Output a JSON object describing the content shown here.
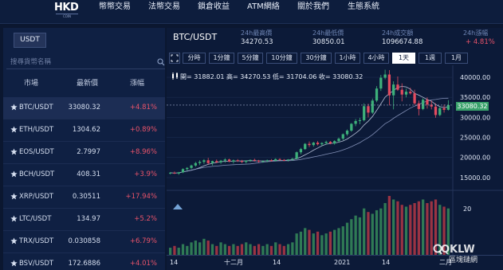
{
  "logo": {
    "text": "HKD",
    "sub": "COIN"
  },
  "nav": [
    {
      "label": "幣幣交易"
    },
    {
      "label": "法幣交易"
    },
    {
      "label": "鎖倉收益"
    },
    {
      "label": "ATM網絡"
    },
    {
      "label": "關於我們"
    },
    {
      "label": "生態系統"
    }
  ],
  "market": {
    "quote_tab": "USDT",
    "search_placeholder": "搜尋貨幣名稱",
    "headers": {
      "market": "市場",
      "price": "最新價",
      "change": "漲幅"
    },
    "rows": [
      {
        "pair": "BTC/USDT",
        "price": "33080.32",
        "change": "+4.81%",
        "selected": true
      },
      {
        "pair": "ETH/USDT",
        "price": "1304.62",
        "change": "+0.89%"
      },
      {
        "pair": "EOS/USDT",
        "price": "2.7997",
        "change": "+8.96%"
      },
      {
        "pair": "BCH/USDT",
        "price": "408.31",
        "change": "+3.9%"
      },
      {
        "pair": "XRP/USDT",
        "price": "0.30511",
        "change": "+17.94%"
      },
      {
        "pair": "LTC/USDT",
        "price": "134.97",
        "change": "+5.2%"
      },
      {
        "pair": "TRX/USDT",
        "price": "0.030858",
        "change": "+6.79%"
      },
      {
        "pair": "BSV/USDT",
        "price": "172.6886",
        "change": "+4.01%"
      }
    ]
  },
  "ticker": {
    "symbol": "BTC/USDT",
    "high_label": "24h最高價",
    "high": "34270.53",
    "low_label": "24h最低價",
    "low": "30850.01",
    "vol_label": "24h成交額",
    "vol": "1096674.88",
    "chg_label": "24h漲幅",
    "chg": "+ 4.81%"
  },
  "intervals": [
    {
      "label": "分時"
    },
    {
      "label": "1分鐘"
    },
    {
      "label": "5分鐘"
    },
    {
      "label": "10分鐘"
    },
    {
      "label": "30分鐘"
    },
    {
      "label": "1小時"
    },
    {
      "label": "4小時"
    },
    {
      "label": "1天",
      "active": true
    },
    {
      "label": "1週"
    },
    {
      "label": "1月"
    }
  ],
  "ohlc": "開= 31882.01  高= 34270.53  低= 31704.06  收= 33080.32",
  "last_price_tag": "33080.32",
  "chart_data": {
    "type": "candlestick",
    "y_ticks": [
      "40000.00",
      "35000.00",
      "30000.00",
      "25000.00",
      "20000.00",
      "15000.00"
    ],
    "ylim": [
      12000,
      42000
    ],
    "x_ticks": [
      "14",
      "十二月",
      "14",
      "2021",
      "14",
      "二月"
    ],
    "volume_tick": "20",
    "ohlc_series": [
      [
        16100,
        16350,
        15800,
        16200
      ],
      [
        16200,
        16500,
        15900,
        16000
      ],
      [
        16000,
        16400,
        15700,
        16300
      ],
      [
        16300,
        17300,
        16100,
        17100
      ],
      [
        17100,
        17600,
        16700,
        17400
      ],
      [
        17400,
        18200,
        17100,
        18000
      ],
      [
        18000,
        18900,
        17700,
        18600
      ],
      [
        18600,
        19300,
        18100,
        18900
      ],
      [
        18900,
        19600,
        18400,
        19300
      ],
      [
        19300,
        19900,
        18300,
        18600
      ],
      [
        18600,
        19200,
        18000,
        19100
      ],
      [
        19100,
        19500,
        18600,
        18800
      ],
      [
        18800,
        19400,
        18400,
        19200
      ],
      [
        19200,
        19800,
        18700,
        19500
      ],
      [
        19500,
        19700,
        18800,
        19000
      ],
      [
        19000,
        19500,
        18500,
        19300
      ],
      [
        19300,
        19600,
        18900,
        19100
      ],
      [
        19100,
        19400,
        18600,
        18900
      ],
      [
        18900,
        19300,
        18500,
        19200
      ],
      [
        19200,
        19500,
        18900,
        19400
      ],
      [
        19400,
        19700,
        19000,
        19200
      ],
      [
        19200,
        19400,
        18700,
        19000
      ],
      [
        19000,
        19300,
        18700,
        19100
      ],
      [
        19100,
        19500,
        18800,
        19300
      ],
      [
        19300,
        19600,
        19000,
        19200
      ],
      [
        19200,
        19800,
        19000,
        19600
      ],
      [
        19600,
        19800,
        19200,
        19400
      ],
      [
        19400,
        19600,
        19100,
        19300
      ],
      [
        19300,
        19600,
        19000,
        19500
      ],
      [
        19500,
        19900,
        19200,
        19700
      ],
      [
        19700,
        21500,
        19500,
        21300
      ],
      [
        21300,
        22400,
        20800,
        22100
      ],
      [
        22100,
        23600,
        21900,
        23400
      ],
      [
        23400,
        24000,
        22600,
        23100
      ],
      [
        23100,
        23900,
        22700,
        23700
      ],
      [
        23700,
        24100,
        23000,
        23300
      ],
      [
        23300,
        23800,
        22900,
        23600
      ],
      [
        23600,
        24200,
        23200,
        23900
      ],
      [
        23900,
        24100,
        23300,
        23500
      ],
      [
        23500,
        24300,
        23200,
        24100
      ],
      [
        24100,
        25000,
        23800,
        24700
      ],
      [
        24700,
        26000,
        24300,
        25800
      ],
      [
        25800,
        27000,
        25400,
        26700
      ],
      [
        26700,
        28600,
        26400,
        28400
      ],
      [
        28400,
        29600,
        27800,
        29100
      ],
      [
        29100,
        29900,
        28300,
        29300
      ],
      [
        29300,
        33500,
        29000,
        32800
      ],
      [
        32800,
        33400,
        30000,
        31200
      ],
      [
        31200,
        34700,
        30900,
        34200
      ],
      [
        34200,
        37800,
        33800,
        37200
      ],
      [
        37200,
        40600,
        36600,
        39900
      ],
      [
        39900,
        41900,
        39500,
        40700
      ],
      [
        40700,
        41800,
        33000,
        35500
      ],
      [
        35500,
        39000,
        32000,
        38200
      ],
      [
        38200,
        40200,
        36600,
        36900
      ],
      [
        36900,
        38500,
        34000,
        35700
      ],
      [
        35700,
        37200,
        35000,
        36400
      ],
      [
        36400,
        37400,
        35700,
        36000
      ],
      [
        36000,
        36900,
        33100,
        33500
      ],
      [
        33500,
        34200,
        30500,
        32100
      ],
      [
        32100,
        34800,
        31800,
        34400
      ],
      [
        34400,
        35000,
        32200,
        33200
      ],
      [
        33200,
        34200,
        32000,
        32700
      ],
      [
        32700,
        33500,
        29900,
        30600
      ],
      [
        30600,
        32700,
        30300,
        32300
      ],
      [
        32300,
        33200,
        31200,
        31900
      ],
      [
        31900,
        34300,
        31700,
        33080
      ]
    ],
    "volume": [
      4,
      5,
      4,
      6,
      5,
      7,
      8,
      7,
      9,
      8,
      6,
      5,
      7,
      6,
      5,
      6,
      5,
      6,
      7,
      6,
      5,
      6,
      5,
      6,
      5,
      7,
      6,
      5,
      6,
      7,
      12,
      13,
      15,
      14,
      12,
      13,
      11,
      12,
      13,
      14,
      15,
      16,
      18,
      20,
      22,
      21,
      26,
      24,
      23,
      25,
      26,
      29,
      33,
      31,
      30,
      28,
      27,
      28,
      29,
      30,
      31,
      29,
      30,
      31,
      28,
      27,
      26
    ]
  },
  "watermark": {
    "main": "QKLW",
    "sub": "區塊鏈網"
  }
}
